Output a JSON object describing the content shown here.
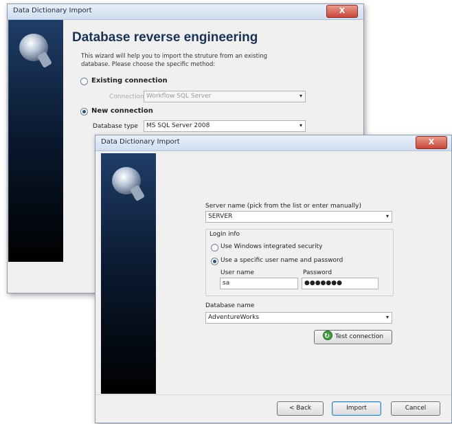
{
  "back_window": {
    "title": "Data Dictionary Import",
    "close_label": "X",
    "heading": "Database reverse engineering",
    "description": "This wizard will help you to import the struture from an existing database. Please choose the specific method:",
    "existing_connection_label": "Existing connection",
    "connection_label": "Connection",
    "connection_value": "Workflow SQL Server",
    "new_connection_label": "New connection",
    "database_type_label": "Database type",
    "database_type_value": "MS SQL Server 2008"
  },
  "front_window": {
    "title": "Data Dictionary Import",
    "close_label": "X",
    "server_name_label": "Server name (pick from the list or enter manually)",
    "server_name_value": "SERVER",
    "login_info_label": "Login info",
    "use_windows_label": "Use Windows integrated security",
    "use_specific_label": "Use a specific user name and password",
    "user_name_label": "User name",
    "user_name_value": "sa",
    "password_label": "Password",
    "password_value": "●●●●●●●",
    "database_name_label": "Database name",
    "database_name_value": "AdventureWorks",
    "test_connection_label": "Test connection",
    "back_label": "< Back",
    "import_label": "Import",
    "cancel_label": "Cancel"
  },
  "icons": {
    "dropdown_arrow": "▾"
  },
  "colors": {
    "sidebar_top": "#1f3d67",
    "sidebar_bottom": "#000000",
    "heading": "#1a3256",
    "close_button": "#c9463a"
  }
}
